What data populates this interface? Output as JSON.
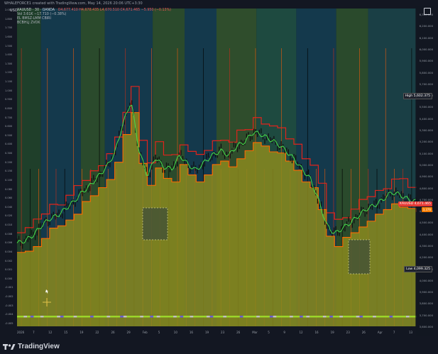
{
  "credit": "WHALEFORCE1 created with TradingView.com, May 14, 2026 20:06 UTC+3:30",
  "header": {
    "symbol_line": "XAUUSD · 30 · OANDA",
    "ohlc": "O4,677.410  H4,678.435  L4,670.510  C4,671.465  −5.950 (−0.13%)",
    "vol": "Vol 3.61K  −17.710 (−0.38%)",
    "ind1": "EL BMSZ-LMM CBIRI",
    "ind2": "BCBHLJ ZVOK",
    "currency": "USD"
  },
  "colors": {
    "bg": "#131722",
    "zone_dark_teal": "#123a4a",
    "zone_green": "#2c4a2c",
    "olive": "#8a8a1e",
    "red_line": "#e0241c",
    "orange_line": "#ff6a00",
    "green_line": "#45e04a",
    "candle": "#111111",
    "price_label_red": "#e53935",
    "price_label_orange": "#f57c00"
  },
  "right_axis": {
    "labels": [
      "6,300.000",
      "6,200.000",
      "6,100.000",
      "6,000.000",
      "5,900.000",
      "5,800.000",
      "5,700.000",
      "5,600.000",
      "5,500.000",
      "5,400.000",
      "5,300.000",
      "5,200.000",
      "5,100.000",
      "5,000.000",
      "4,900.000",
      "4,800.000",
      "4,700.000",
      "4,600.000",
      "4,500.000",
      "4,400.000",
      "4,300.000",
      "4,200.000",
      "4,100.000",
      "4,000.000",
      "3,900.000",
      "3,800.000",
      "3,700.000",
      "3,600.000"
    ],
    "high_label": "High",
    "high_value": "5,602.375",
    "low_label": "Low",
    "low_value": "4,099.325",
    "last_label": "XAUUSD",
    "last_value": "4,671.465",
    "last_sub": "3,376"
  },
  "left_axis": {
    "labels": [
      "2.000",
      "1.800",
      "1.700",
      "1.600",
      "1.500",
      "1.400",
      "1.300",
      "1.200",
      "1.100",
      "1.000",
      "0.900",
      "0.800",
      "0.700",
      "0.600",
      "0.500",
      "0.400",
      "0.300",
      "0.200",
      "0.150",
      "0.100",
      "0.080",
      "0.060",
      "0.040",
      "0.020",
      "0.010",
      "0.008",
      "0.006",
      "0.004",
      "0.002",
      "0.001",
      "0.000",
      "-0.001",
      "-0.002",
      "-0.003",
      "-0.004",
      "-0.005"
    ]
  },
  "bottom_axis": {
    "labels": [
      "2026",
      "7",
      "12",
      "15",
      "19",
      "22",
      "26",
      "29",
      "Feb",
      "5",
      "10",
      "16",
      "19",
      "23",
      "26",
      "Mar",
      "5",
      "9",
      "12",
      "16",
      "19",
      "23",
      "26",
      "Apr",
      "7",
      "13"
    ]
  },
  "footer": {
    "brand": "TradingView"
  },
  "chart_data": {
    "type": "line",
    "title": "",
    "series": [
      {
        "name": "",
        "values": [
          4320,
          4340,
          4390,
          4470,
          4530,
          4560,
          4620,
          4680,
          4760,
          4820,
          4900,
          4980,
          5100,
          5350,
          5550,
          5120,
          4900,
          5060,
          4980,
          4960,
          5080,
          5000,
          4950,
          5020,
          5080,
          5120,
          5080,
          5160,
          5200,
          5280,
          5260,
          5220,
          5180,
          5120,
          5050,
          4960,
          4880,
          4700,
          4480,
          4400,
          4450,
          4500,
          4560,
          4620,
          4650,
          4700,
          4760,
          4740,
          4700,
          4680
        ]
      }
    ],
    "ylim": [
      3600,
      6350
    ],
    "y_high": 5602.375,
    "y_low": 4099.325,
    "last": 4671.465
  }
}
